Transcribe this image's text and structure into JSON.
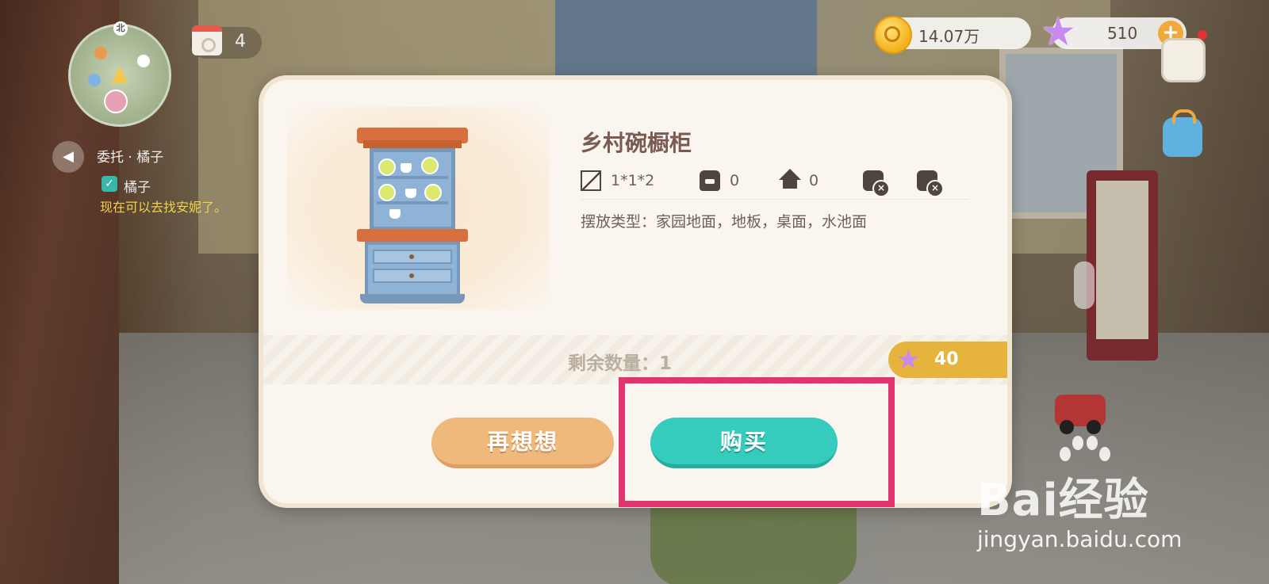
{
  "hud": {
    "map_north": "北",
    "calendar_count": "4",
    "task": {
      "title": "委托 · 橘子",
      "subtask_name": "橘子",
      "hint": "现在可以去找安妮了。"
    },
    "currency": {
      "coins": "14.07万",
      "stars": "510",
      "add_label": "+"
    }
  },
  "dialog": {
    "item_name": "乡村碗橱柜",
    "stats": {
      "size": "1*1*2",
      "bag_count": "0",
      "home_count": "0"
    },
    "placement_type": "摆放类型：家园地面，地板，桌面，水池面",
    "remaining": "剩余数量：1",
    "price": "40",
    "cancel_label": "再想想",
    "buy_label": "购买"
  },
  "watermark": {
    "brand": "Bai经验",
    "url": "jingyan.baidu.com"
  },
  "colors": {
    "buy_button": "#35cbbd",
    "cancel_button": "#f0b97c",
    "highlight_box": "#e0356e",
    "price_tag": "#e6b43c"
  }
}
